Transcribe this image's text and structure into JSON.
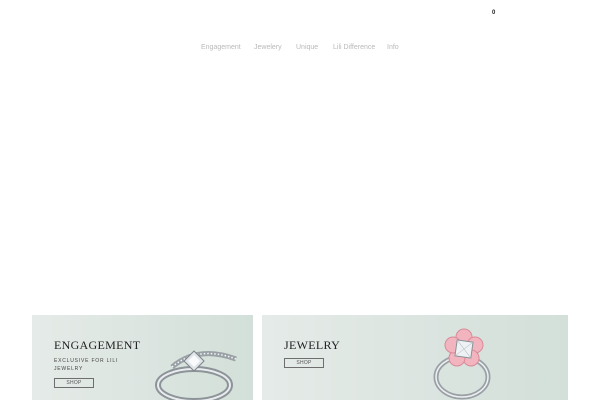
{
  "cart": {
    "count": "0"
  },
  "nav": {
    "items": [
      {
        "label": "Engagement"
      },
      {
        "label": "Jewelery"
      },
      {
        "label": "Unique"
      },
      {
        "label": "Lili Difference"
      },
      {
        "label": "Info"
      }
    ]
  },
  "cards": [
    {
      "title": "ENGAGEMENT",
      "subtitle": "EXCLUSIVE FOR LILI JEWELRY",
      "button": "SHOP",
      "image": "silver-diamond-engagement-ring"
    },
    {
      "title": "JEWELRY",
      "subtitle": "",
      "button": "SHOP",
      "image": "pink-flower-diamond-ring"
    }
  ],
  "colors": {
    "card_bg_start": "#e5ebe8",
    "card_bg_end": "#d3dfd9",
    "nav_text": "#b9b9b9",
    "accent_pink": "#e79aa6"
  }
}
